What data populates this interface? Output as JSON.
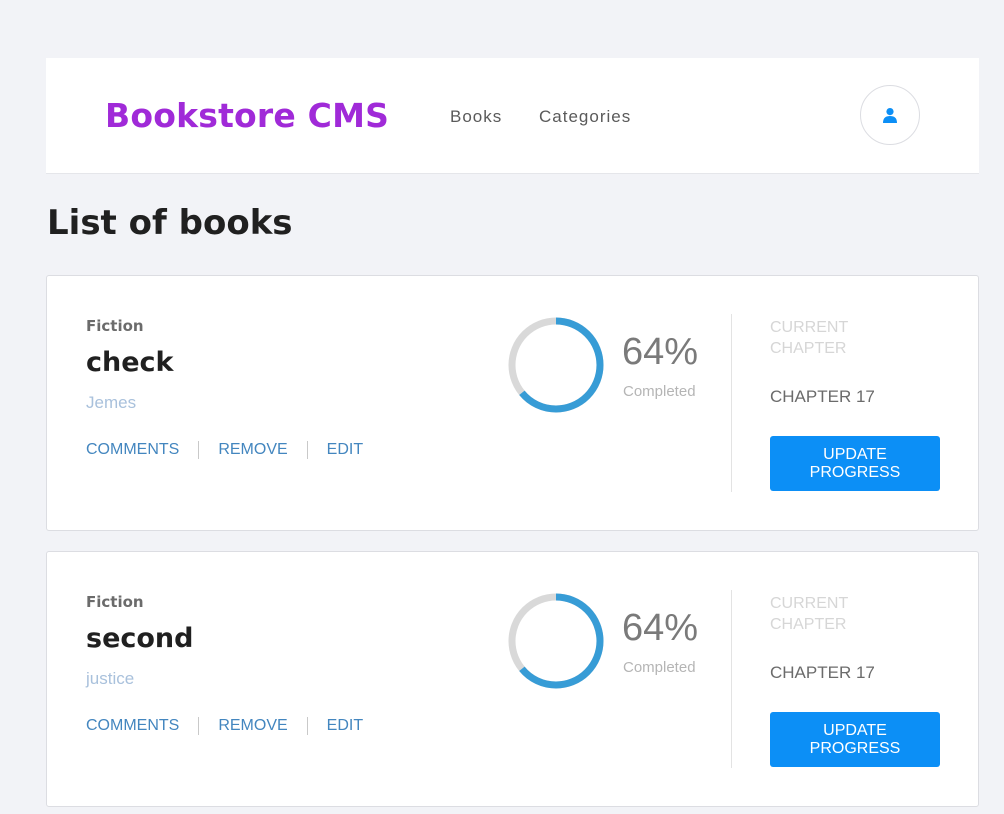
{
  "header": {
    "logo": "Bookstore CMS",
    "nav": [
      {
        "label": "Books"
      },
      {
        "label": "Categories"
      }
    ],
    "avatar_icon": "user-icon"
  },
  "page_title": "List of books",
  "books": [
    {
      "genre": "Fiction",
      "title": "check",
      "author": "Jemes",
      "actions": {
        "comments": "COMMENTS",
        "remove": "REMOVE",
        "edit": "EDIT"
      },
      "progress_percent": 64,
      "percent_label": "64%",
      "completed_label": "Completed",
      "current_chapter_label": "CURRENT CHAPTER",
      "chapter": "CHAPTER 17",
      "update_button": "UPDATE PROGRESS"
    },
    {
      "genre": "Fiction",
      "title": "second",
      "author": "justice",
      "actions": {
        "comments": "COMMENTS",
        "remove": "REMOVE",
        "edit": "EDIT"
      },
      "progress_percent": 64,
      "percent_label": "64%",
      "completed_label": "Completed",
      "current_chapter_label": "CURRENT CHAPTER",
      "chapter": "CHAPTER 17",
      "update_button": "UPDATE PROGRESS"
    }
  ],
  "colors": {
    "brand": "#a02ad8",
    "primary": "#0c8ff6",
    "progress": "#379cd6",
    "progress_track": "#d9d9d9",
    "action_link": "#4386bf"
  }
}
